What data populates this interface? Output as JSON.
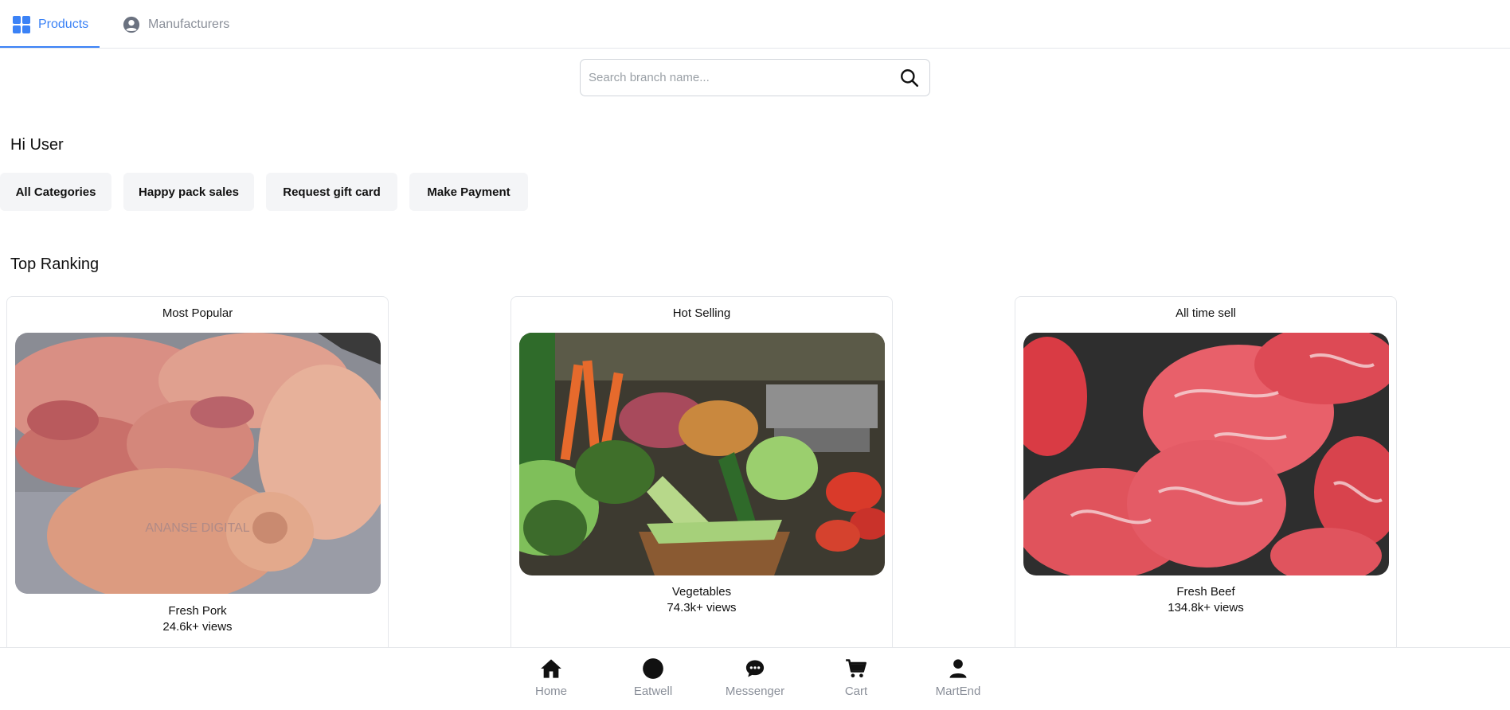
{
  "tabs": [
    {
      "label": "Products",
      "icon": "grid-icon",
      "active": true
    },
    {
      "label": "Manufacturers",
      "icon": "user-circle-icon",
      "active": false
    }
  ],
  "search": {
    "placeholder": "Search branch name..."
  },
  "greeting": "Hi User",
  "chips": [
    "All Categories",
    "Happy pack sales",
    "Request gift card",
    "Make Payment"
  ],
  "top_ranking": {
    "title": "Top Ranking",
    "cards": [
      {
        "heading": "Most Popular",
        "name": "Fresh Pork",
        "views": "24.6k+ views",
        "image": "pork-photo",
        "watermark": "ANANSE DIGITAL"
      },
      {
        "heading": "Hot Selling",
        "name": "Vegetables",
        "views": "74.3k+ views",
        "image": "vegetables-photo"
      },
      {
        "heading": "All time sell",
        "name": "Fresh Beef",
        "views": "134.8k+ views",
        "image": "beef-photo"
      }
    ]
  },
  "bottom_nav": [
    {
      "label": "Home",
      "icon": "home-icon"
    },
    {
      "label": "Eatwell",
      "icon": "circle-icon"
    },
    {
      "label": "Messenger",
      "icon": "chat-icon"
    },
    {
      "label": "Cart",
      "icon": "cart-icon"
    },
    {
      "label": "MartEnd",
      "icon": "person-icon"
    }
  ],
  "colors": {
    "accent": "#3b82f6",
    "muted": "#8a8f99",
    "chip_bg": "#f4f5f7",
    "border": "#e5e7eb"
  }
}
